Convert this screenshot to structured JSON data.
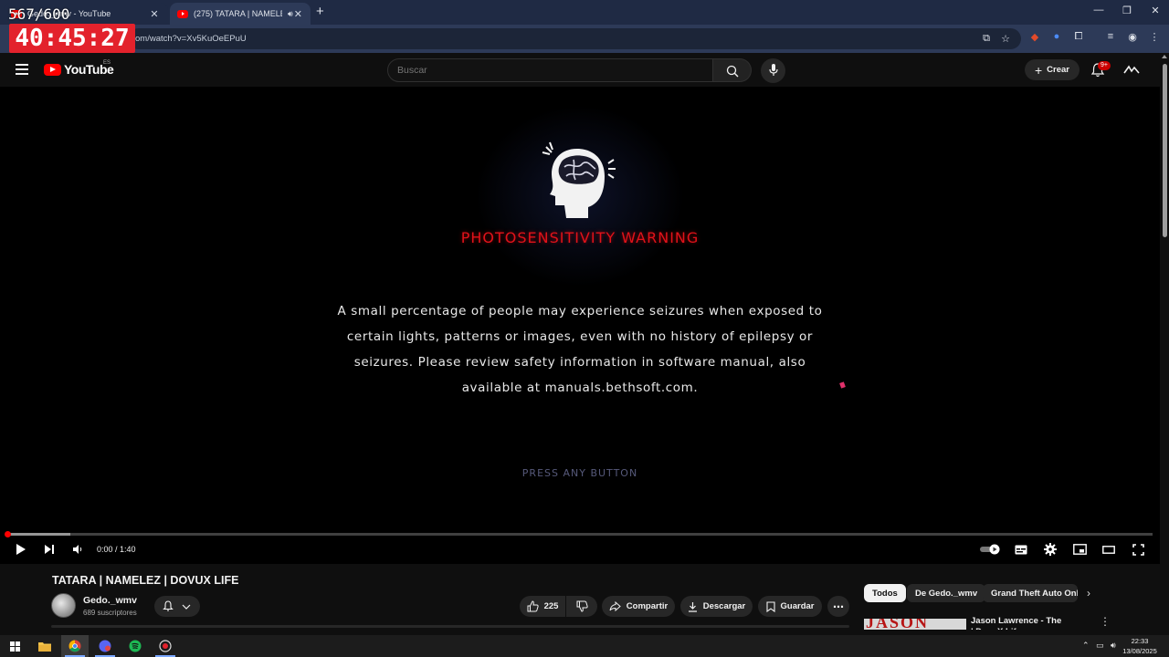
{
  "recorder": {
    "counter": "567/600",
    "timer": "40:45:27"
  },
  "browser": {
    "tabs": [
      {
        "title": "Gedo._wmv - YouTube",
        "active": false
      },
      {
        "title": "(275) TATARA | NAMELEZ | D",
        "active": true
      }
    ],
    "url": "om/watch?v=Xv5KuOeEPuU",
    "accent": "#2d3a58"
  },
  "youtube": {
    "logo_text": "YouTube",
    "region": "ES",
    "search_placeholder": "Buscar",
    "create_label": "Crear",
    "notif_badge": "9+"
  },
  "video": {
    "warning_title": "PHOTOSENSITIVITY WARNING",
    "warning_lines": [
      "A small percentage of people may experience seizures when exposed to",
      "certain lights, patterns or images, even with no history of epilepsy or",
      "seizures. Please review safety information in software manual, also",
      "available at manuals.bethsoft.com."
    ],
    "press_text": "PRESS ANY BUTTON",
    "time": "0:00 / 1:40",
    "progress_fraction": 0.0,
    "buffered_fraction": 0.055
  },
  "details": {
    "title": "TATARA | NAMELEZ | DOVUX LIFE",
    "channel": "Gedo._wmv",
    "subscribers": "689 suscriptores",
    "likes": "225",
    "share_label": "Compartir",
    "download_label": "Descargar",
    "save_label": "Guardar"
  },
  "sidebar": {
    "chips": [
      "Todos",
      "De Gedo._wmv",
      "Grand Theft Auto Online"
    ],
    "recommendation": {
      "thumb_text": "JASON",
      "title_line1": "Jason Lawrence - The Evolution",
      "title_line2": "| DovuX Life"
    }
  },
  "taskbar": {
    "time": "22:33",
    "date": "13/08/2025"
  }
}
